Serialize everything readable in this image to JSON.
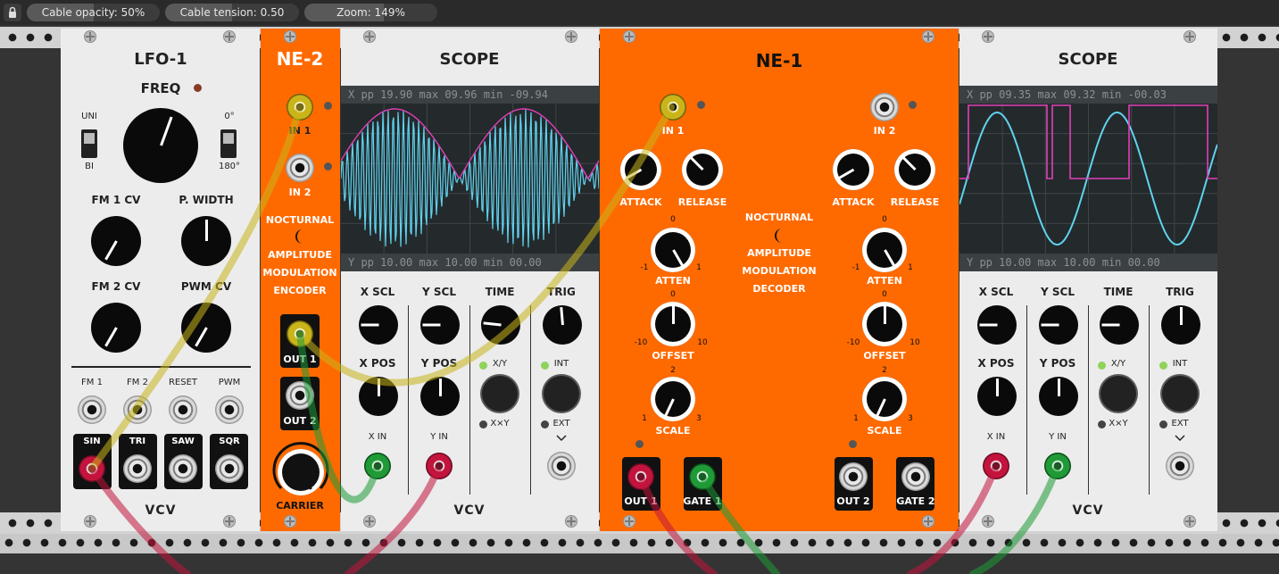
{
  "toolbar": {
    "lock_icon": "lock-icon",
    "cable_opacity": {
      "label": "Cable opacity: 50%",
      "level": 0.5
    },
    "cable_tension": {
      "label": "Cable tension: 0.50",
      "level": 0.5
    },
    "zoom": {
      "label": "Zoom: 149%",
      "level": 0.6
    }
  },
  "lfo": {
    "title": "LFO-1",
    "freq": "FREQ",
    "uni": "UNI",
    "bi": "BI",
    "deg0": "0°",
    "deg180": "180°",
    "fm1cv": "FM 1 CV",
    "pwidth": "P. WIDTH",
    "fm2cv": "FM 2 CV",
    "pwmcv": "PWM CV",
    "fm1": "FM 1",
    "fm2": "FM 2",
    "reset": "RESET",
    "pwm": "PWM",
    "sin": "SIN",
    "tri": "TRI",
    "saw": "SAW",
    "sqr": "SQR",
    "logo": "VCV"
  },
  "ne2": {
    "title": "NE-2",
    "in1": "IN 1",
    "in2": "IN 2",
    "desc1": "NOCTURNAL",
    "desc2": "AMPLITUDE",
    "desc3": "MODULATION",
    "desc4": "ENCODER",
    "out1": "OUT 1",
    "out2": "OUT 2",
    "carrier": "CARRIER"
  },
  "scope1": {
    "title": "SCOPE",
    "hdr_x": "X   pp  19.90  max  09.96  min  -09.94",
    "hdr_y": "Y   pp  10.00  max  10.00  min  00.00",
    "xscl": "X SCL",
    "yscl": "Y SCL",
    "time": "TIME",
    "trig": "TRIG",
    "xpos": "X POS",
    "ypos": "Y POS",
    "xy": "X/Y",
    "xxy": "X×Y",
    "int": "INT",
    "ext": "EXT",
    "xin": "X IN",
    "yin": "Y IN",
    "logo": "VCV"
  },
  "ne1": {
    "title": "NE-1",
    "in1": "IN 1",
    "in2": "IN 2",
    "attack": "ATTACK",
    "release": "RELEASE",
    "desc1": "NOCTURNAL",
    "desc2": "AMPLITUDE",
    "desc3": "MODULATION",
    "desc4": "DECODER",
    "atten": "ATTEN",
    "offset": "OFFSET",
    "scale": "SCALE",
    "t0": "0",
    "tm1": "-1",
    "t1": "1",
    "tm10": "-10",
    "t10": "10",
    "t2": "2",
    "t3": "3",
    "out1": "OUT 1",
    "gate1": "GATE 1",
    "out2": "OUT 2",
    "gate2": "GATE 2"
  },
  "scope2": {
    "title": "SCOPE",
    "hdr_x": "X   pp  09.35  max  09.32  min  -00.03",
    "hdr_y": "Y   pp  10.00  max  10.00  min  00.00",
    "xscl": "X SCL",
    "yscl": "Y SCL",
    "time": "TIME",
    "trig": "TRIG",
    "xpos": "X POS",
    "ypos": "Y POS",
    "xy": "X/Y",
    "xxy": "X×Y",
    "int": "INT",
    "ext": "EXT",
    "xin": "X IN",
    "yin": "Y IN",
    "logo": "VCV"
  },
  "colors": {
    "orange": "#ff6a00",
    "panel": "#ececec",
    "yellow": "#c9b41a",
    "red": "#c2143d",
    "green": "#1f9a37",
    "cyan": "#5fd3ee",
    "magenta": "#e040b8"
  }
}
